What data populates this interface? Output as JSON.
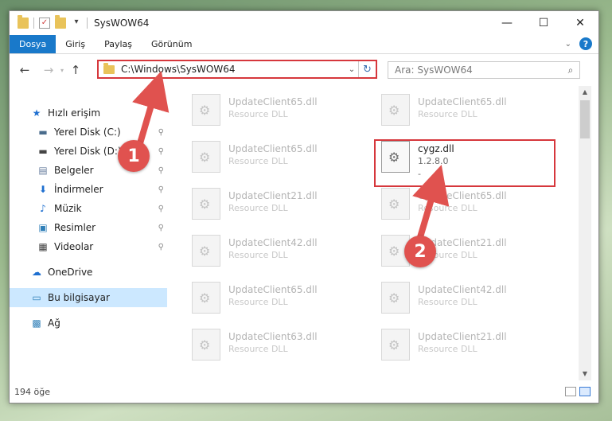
{
  "window": {
    "title": "SysWOW64",
    "controls": {
      "minimize": "—",
      "maximize": "☐",
      "close": "✕"
    }
  },
  "ribbon": {
    "tabs": [
      "Dosya",
      "Giriş",
      "Paylaş",
      "Görünüm"
    ],
    "help": "?"
  },
  "nav": {
    "back": "←",
    "forward": "→",
    "up": "↑",
    "address": "C:\\Windows\\SysWOW64",
    "search_placeholder": "Ara: SysWOW64"
  },
  "sidebar": {
    "items": [
      {
        "label": "Hızlı erişim",
        "icon": "star-icon",
        "glyph": "★",
        "color": "#1e6fd0",
        "pinned": false
      },
      {
        "label": "Yerel Disk (C:)",
        "icon": "drive-icon",
        "glyph": "▬",
        "color": "#4a6c8c",
        "pinned": true
      },
      {
        "label": "Yerel Disk (D:)",
        "icon": "drive-icon",
        "glyph": "▬",
        "color": "#444444",
        "pinned": true
      },
      {
        "label": "Belgeler",
        "icon": "documents-icon",
        "glyph": "▤",
        "color": "#6a7fa0",
        "pinned": true
      },
      {
        "label": "İndirmeler",
        "icon": "download-icon",
        "glyph": "⬇",
        "color": "#1e6fd0",
        "pinned": true
      },
      {
        "label": "Müzik",
        "icon": "music-icon",
        "glyph": "♪",
        "color": "#1e6fd0",
        "pinned": true
      },
      {
        "label": "Resimler",
        "icon": "pictures-icon",
        "glyph": "▣",
        "color": "#2f7fb8",
        "pinned": true
      },
      {
        "label": "Videolar",
        "icon": "video-icon",
        "glyph": "▦",
        "color": "#444444",
        "pinned": true
      },
      {
        "label": "OneDrive",
        "icon": "cloud-icon",
        "glyph": "☁",
        "color": "#1e6fd0",
        "pinned": false
      },
      {
        "label": "Bu bilgisayar",
        "icon": "computer-icon",
        "glyph": "▭",
        "color": "#2f7fb8",
        "pinned": false,
        "selected": true
      },
      {
        "label": "Ağ",
        "icon": "network-icon",
        "glyph": "▩",
        "color": "#2f7fb8",
        "pinned": false
      }
    ],
    "pin_glyph": "📌"
  },
  "files": [
    {
      "name": "UpdateClient65.dll",
      "desc": "Resource DLL"
    },
    {
      "name": "UpdateClient65.dll",
      "desc": "Resource DLL"
    },
    {
      "name": "UpdateClient65.dll",
      "desc": "Resource DLL"
    },
    {
      "name": "cygz.dll",
      "desc": "1.2.8.0",
      "extra": "-",
      "active": true
    },
    {
      "name": "UpdateClient21.dll",
      "desc": "Resource DLL"
    },
    {
      "name": "UpdateClient65.dll",
      "desc": "Resource DLL"
    },
    {
      "name": "UpdateClient42.dll",
      "desc": "Resource DLL"
    },
    {
      "name": "UpdateClient21.dll",
      "desc": "Resource DLL"
    },
    {
      "name": "UpdateClient65.dll",
      "desc": "Resource DLL"
    },
    {
      "name": "UpdateClient42.dll",
      "desc": "Resource DLL"
    },
    {
      "name": "UpdateClient63.dll",
      "desc": "Resource DLL"
    },
    {
      "name": "UpdateClient21.dll",
      "desc": "Resource DLL"
    }
  ],
  "status": {
    "count": "194 öğe"
  },
  "annotations": [
    {
      "number": "1"
    },
    {
      "number": "2"
    }
  ],
  "colors": {
    "accent": "#1979ca",
    "highlight": "#d6373c",
    "badge": "#e0524f",
    "selection": "#cce8ff"
  }
}
